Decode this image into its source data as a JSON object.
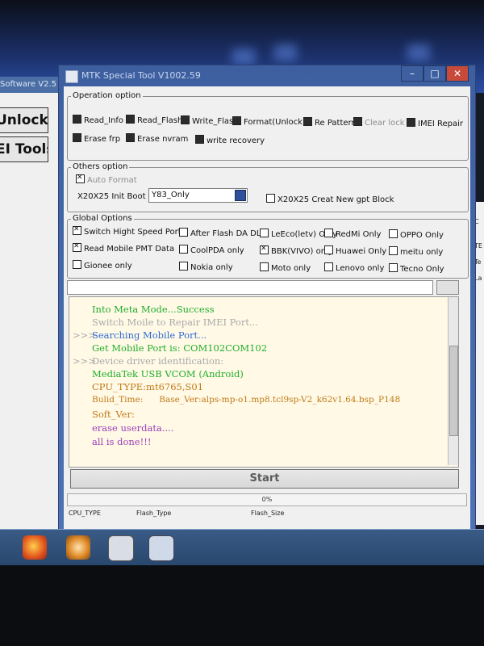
{
  "main_window": {
    "title": "MTK Special Tool V1002.59"
  },
  "left_window": {
    "title": "Software V2.5",
    "unlock_button": "Unlock",
    "tools_button": "EI Tools"
  },
  "window_controls": {
    "minimize": "–",
    "maximize": "□",
    "close": "✕"
  },
  "operation_option": {
    "title": "Operation option",
    "items": [
      {
        "label": "Read_Info",
        "checked": false
      },
      {
        "label": "Read_Flash",
        "checked": false
      },
      {
        "label": "Write_Flash",
        "checked": false
      },
      {
        "label": "Format(Unlock)",
        "checked": false
      },
      {
        "label": "Re Pattern",
        "checked": false
      },
      {
        "label": "Clear lock",
        "checked": false
      },
      {
        "label": "IMEI Repair",
        "checked": false
      },
      {
        "label": "Erase frp",
        "checked": false
      },
      {
        "label": "Erase nvram",
        "checked": false
      },
      {
        "label": "write recovery",
        "checked": false
      }
    ]
  },
  "others_option": {
    "title": "Others option",
    "auto_format": "Auto Format",
    "init_boot_label": "X20X25 Init Boot",
    "init_boot_value": "Y83_Only",
    "gpt_block": "X20X25 Creat New gpt Block"
  },
  "global_options": {
    "title": "Global Options",
    "items": [
      {
        "label": "Switch Hight Speed Port",
        "checked": true
      },
      {
        "label": "After Flash DA DL",
        "checked": false
      },
      {
        "label": "LeEco(letv) Only",
        "checked": false
      },
      {
        "label": "RedMi Only",
        "checked": false
      },
      {
        "label": "OPPO Only",
        "checked": false
      },
      {
        "label": "Read Mobile PMT Data",
        "checked": true
      },
      {
        "label": "CoolPDA only",
        "checked": false
      },
      {
        "label": "BBK(VIVO) only",
        "checked": true
      },
      {
        "label": "Huawei Only",
        "checked": false
      },
      {
        "label": "meitu only",
        "checked": false
      },
      {
        "label": "Gionee only",
        "checked": false
      },
      {
        "label": "Nokia only",
        "checked": false
      },
      {
        "label": "Moto only",
        "checked": false
      },
      {
        "label": "Lenovo only",
        "checked": false
      },
      {
        "label": "Tecno Only",
        "checked": false
      }
    ]
  },
  "log": {
    "lines": [
      {
        "prefix": "",
        "text": "Into Meta Mode...Success",
        "color": "#1fae2a"
      },
      {
        "prefix": "",
        "text": "Switch Moile to Repair IMEI Port...",
        "color": "#a8a8a8"
      },
      {
        "prefix": ">>>",
        "text": "Searching Mobile Port...",
        "color": "#2f6bd6"
      },
      {
        "prefix": "",
        "text": "Get Mobile Port is: COM102COM102",
        "color": "#1fae2a"
      },
      {
        "prefix": ">>>",
        "text": "Device driver identification:",
        "color": "#a8a8a8"
      },
      {
        "prefix": "",
        "text": "MediaTek USB VCOM (Android)",
        "color": "#1fae2a"
      },
      {
        "prefix": "",
        "text": "CPU_TYPE:mt6765,S01",
        "color": "#c07a18"
      },
      {
        "prefix": "",
        "text": "Bulid_Time:      Base_Ver:alps-mp-o1.mp8.tcl9sp-V2_k62v1.64.bsp_P148",
        "color": "#c07a18"
      },
      {
        "prefix": "",
        "text": "Soft_Ver:",
        "color": "#c07a18"
      },
      {
        "prefix": "",
        "text": "erase userdata....",
        "color": "#9b3fb8"
      },
      {
        "prefix": "",
        "text": "all is done!!!",
        "color": "#9b3fb8"
      }
    ]
  },
  "start_button": "Start",
  "progress": {
    "text": "0%",
    "value": 0
  },
  "status_bar": {
    "cpu_type": "CPU_TYPE",
    "flash_type": "Flash_Type",
    "flash_size": "Flash_Size"
  },
  "colors": {
    "title_bar": "#4f72b4",
    "log_bg": "#fff9e6"
  }
}
